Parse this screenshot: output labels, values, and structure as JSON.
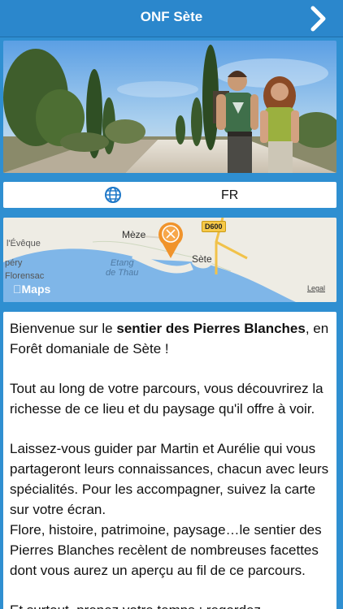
{
  "nav": {
    "title": "ONF Sète",
    "next_icon": "chevron-right-icon"
  },
  "hero": {
    "image": "hero-photo-characters-on-path"
  },
  "language": {
    "icon": "globe-icon",
    "code": "FR"
  },
  "map": {
    "labels": {
      "l_eveque": "l'Évêque",
      "meze": "Mèze",
      "etang": "Etang\nde Thau",
      "pery": "péry",
      "florensac": "Florensac",
      "sete": "Sète"
    },
    "road": "D600",
    "brand": "Maps",
    "legal": "Legal",
    "pin_color": "#f0932b"
  },
  "content": {
    "p1_a": "Bienvenue sur le ",
    "p1_bold": "sentier des Pierres Blanches",
    "p1_b": ", en Forêt domaniale de Sète !",
    "p2": "Tout au long de votre parcours, vous découvrirez la richesse de ce lieu et du paysage qu'il offre à voir.",
    "p3": "Laissez-vous guider par Martin et Aurélie qui vous partageront leurs connaissances, chacun avec leurs spécialités. Pour les accompagner, suivez la carte sur votre écran.",
    "p4": "Flore, histoire, patrimoine, paysage…le sentier des Pierres Blanches recèlent de nombreuses facettes dont vous aurez un aperçu au fil de ce parcours.",
    "p5": "Et surtout, prenez votre temps ; regardez,"
  }
}
